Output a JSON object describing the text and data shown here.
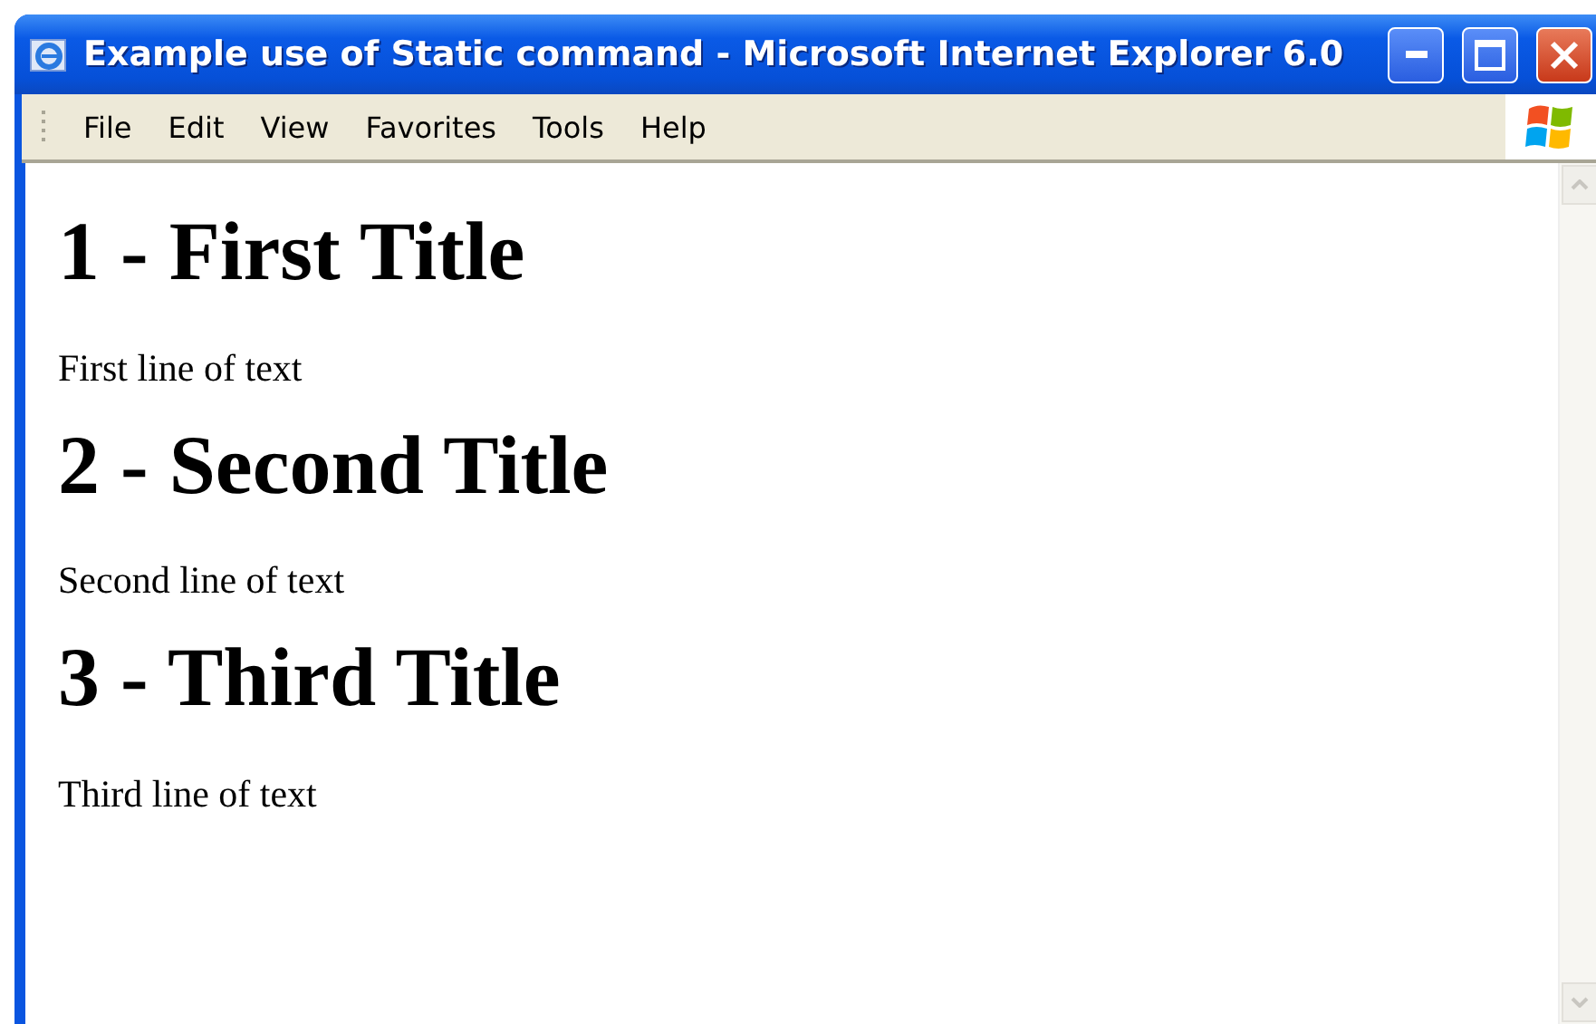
{
  "window": {
    "title": "Example use of Static command - Microsoft Internet Explorer 6.0"
  },
  "menu": [
    "File",
    "Edit",
    "View",
    "Favorites",
    "Tools",
    "Help"
  ],
  "content": [
    {
      "kind": "heading",
      "text": "1 - First Title"
    },
    {
      "kind": "paragraph",
      "text": "First line of text"
    },
    {
      "kind": "heading",
      "text": "2 - Second Title"
    },
    {
      "kind": "paragraph",
      "text": "Second line of text"
    },
    {
      "kind": "heading",
      "text": "3 - Third Title"
    },
    {
      "kind": "paragraph",
      "text": "Third line of text"
    }
  ]
}
